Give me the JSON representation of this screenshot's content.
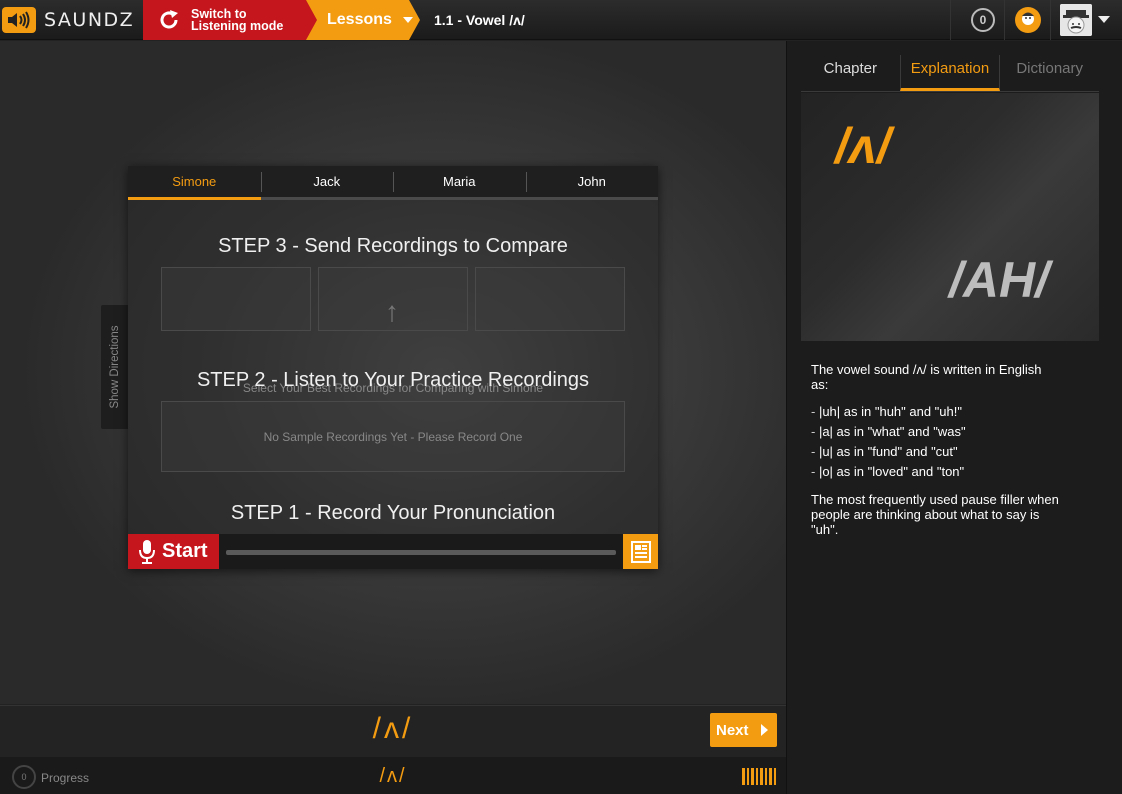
{
  "app": {
    "brand": "SAUNDZ",
    "accent_color": "#f39c12",
    "alert_color": "#c4161c"
  },
  "header": {
    "switch_mode_label": "Switch to Listening mode",
    "lessons_label": "Lessons",
    "lesson_title": "1.1 - Vowel /ʌ/",
    "notification_count": "0",
    "icons": [
      "speaker-logo-icon",
      "refresh-icon",
      "chevron-down-icon",
      "coin-icon",
      "avatar",
      "caret-down-icon"
    ]
  },
  "speakers": [
    {
      "name": "Simone",
      "active": true
    },
    {
      "name": "Jack",
      "active": false
    },
    {
      "name": "Maria",
      "active": false
    },
    {
      "name": "John",
      "active": false
    }
  ],
  "practice": {
    "show_directions": "Show Directions",
    "step3_title": "STEP 3 - Send Recordings to Compare",
    "step3_hint": "Select Your Best Recordings for Comparing with Simone",
    "step2_title": "STEP 2 - Listen to Your Practice Recordings",
    "step2_empty": "No Sample Recordings Yet - Please Record One",
    "step1_title": "STEP 1 - Record Your Pronunciation",
    "start_label": "Start"
  },
  "sidebar": {
    "tabs": [
      {
        "label": "Chapter",
        "state": "normal"
      },
      {
        "label": "Explanation",
        "state": "active"
      },
      {
        "label": "Dictionary",
        "state": "inactive"
      }
    ],
    "card_symbol": "/ʌ/",
    "card_sound": "/AH/",
    "intro": "The vowel sound /ʌ/ is written in English as:",
    "spellings": [
      "|uh| as in \"huh\" and \"uh!\"",
      "|a| as in \"what\" and \"was\"",
      "|u| as in \"fund\" and \"cut\"",
      "|o| as in \"loved\" and \"ton\""
    ],
    "note": "The most frequently used pause filler when people are thinking about what to say is \"uh\"."
  },
  "footer": {
    "nav_symbol": "/ʌ/",
    "next_label": "Next",
    "progress_count": "0",
    "progress_label": "Progress",
    "status_symbol": "/ʌ/"
  }
}
